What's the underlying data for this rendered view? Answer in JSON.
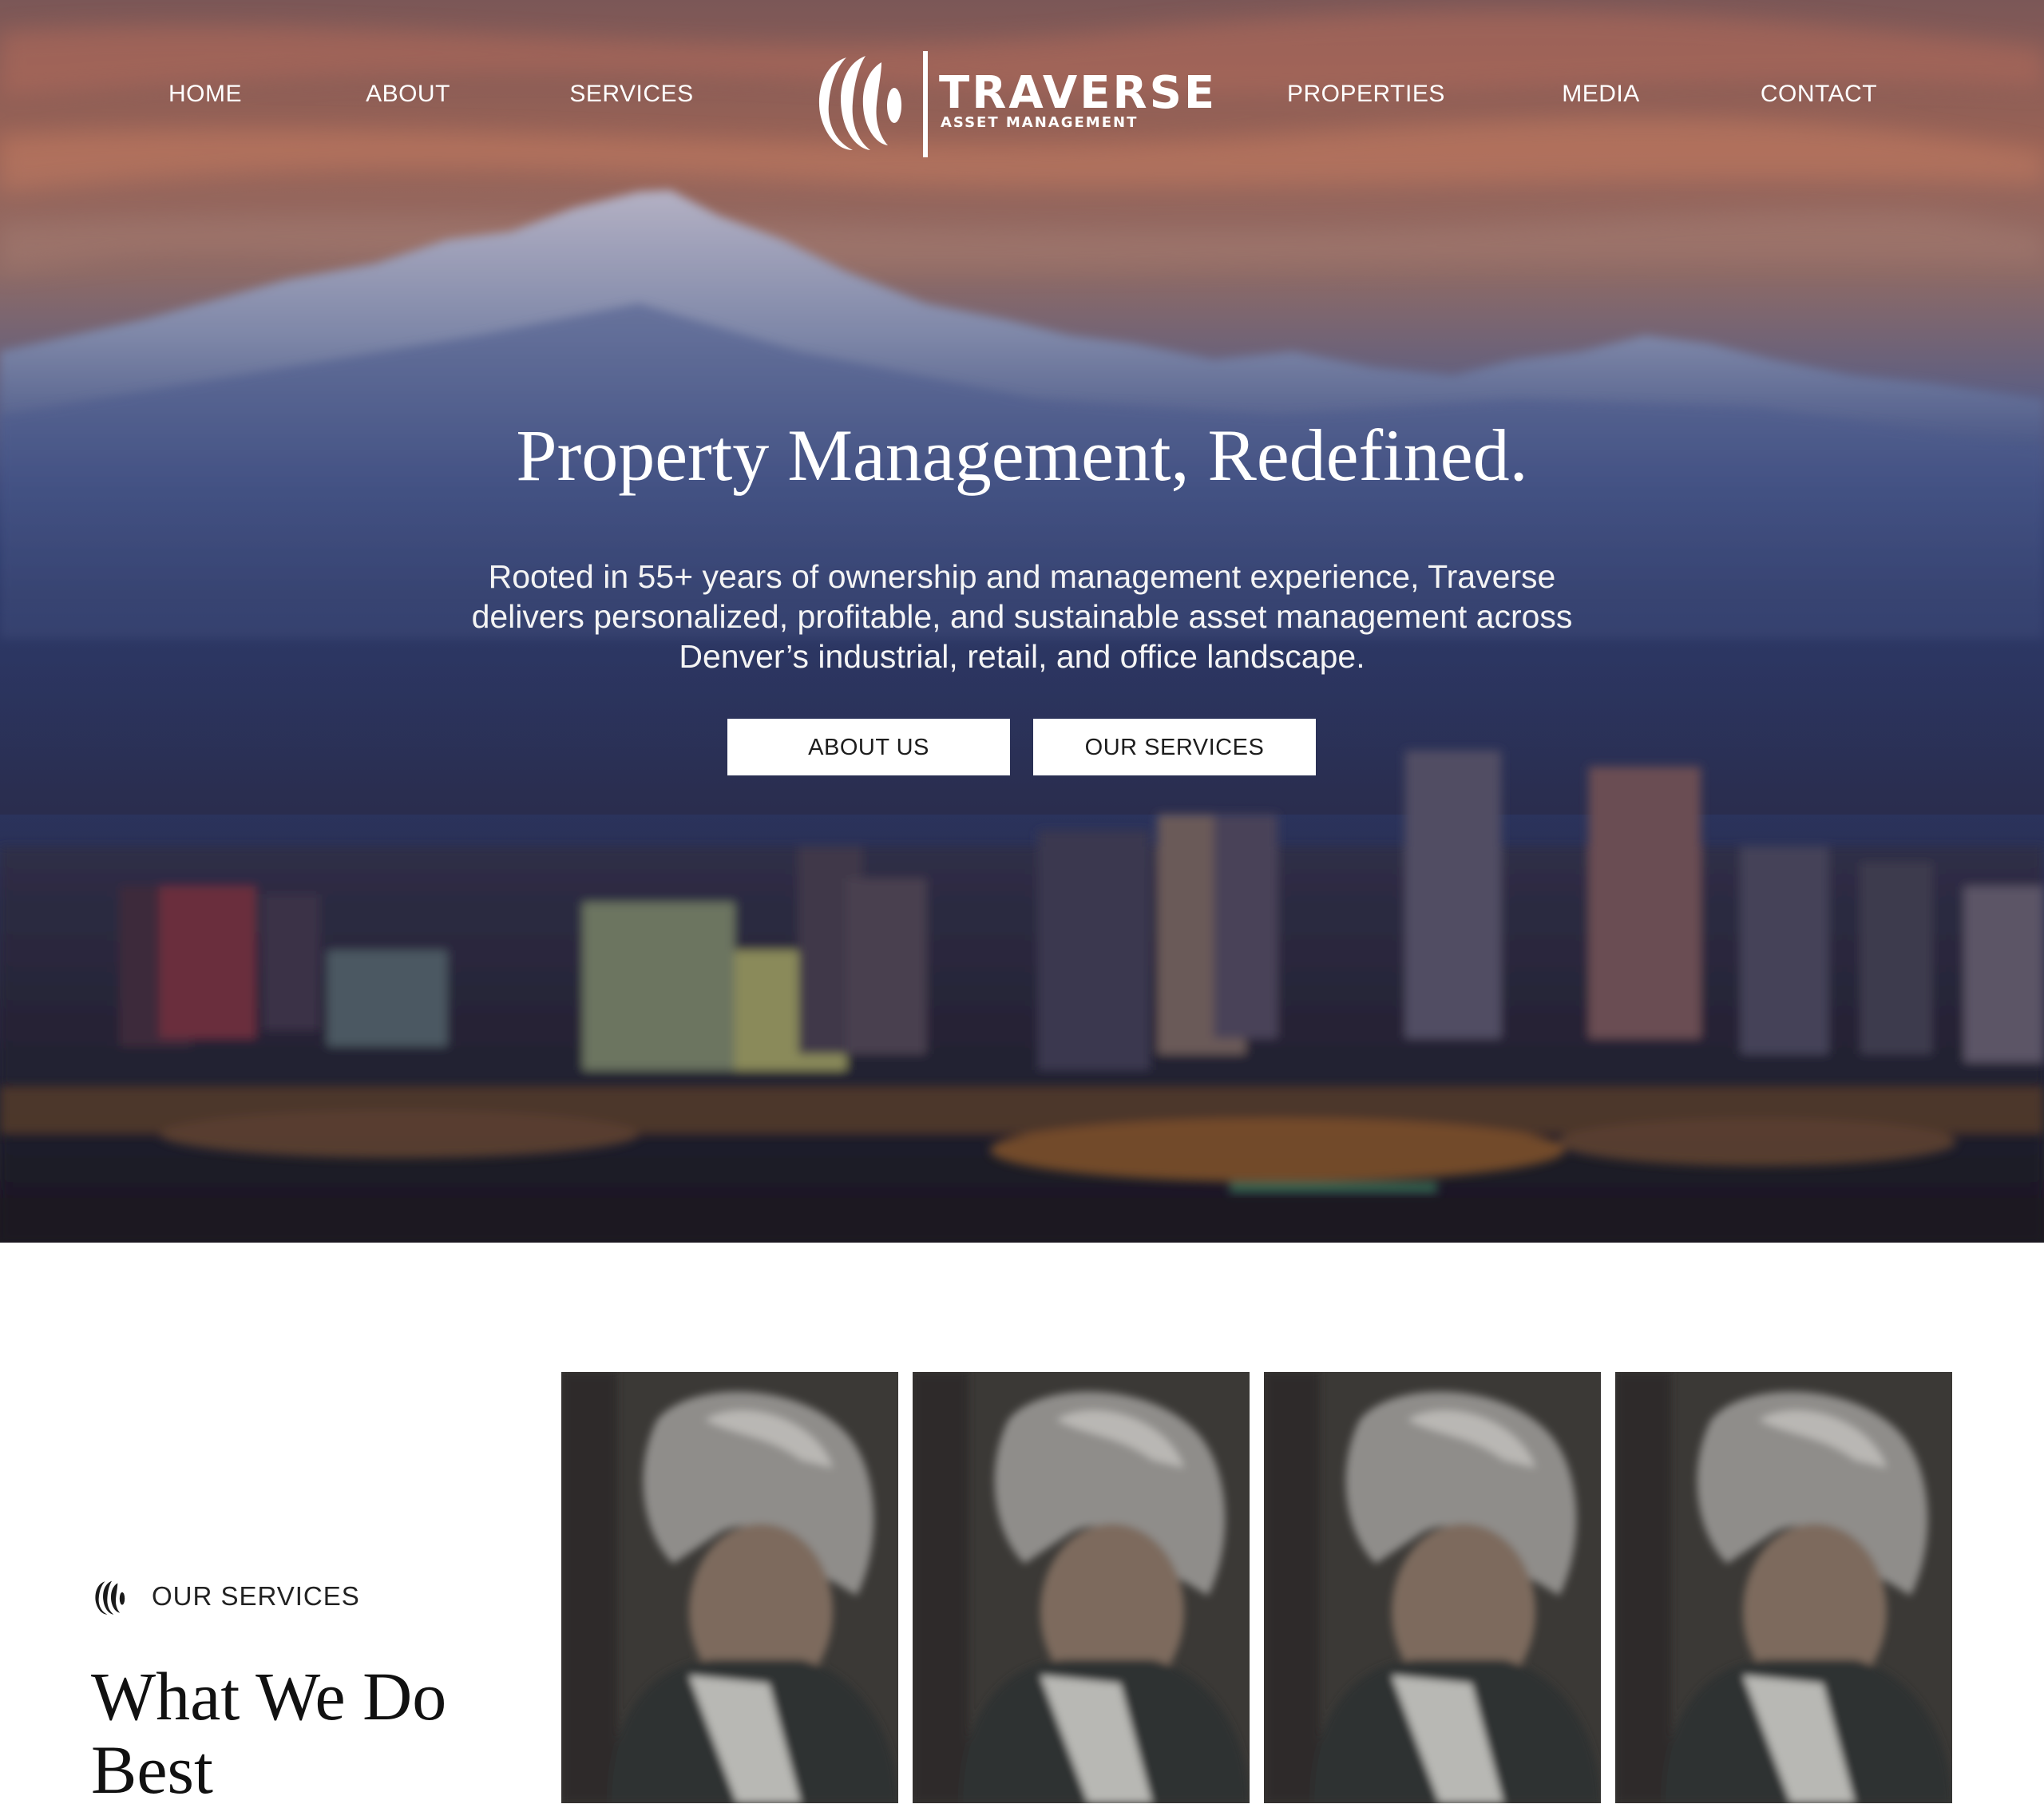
{
  "nav": {
    "left_items": [
      {
        "label": "HOME"
      },
      {
        "label": "ABOUT"
      },
      {
        "label": "SERVICES"
      }
    ],
    "right_items": [
      {
        "label": "PROPERTIES"
      },
      {
        "label": "MEDIA"
      },
      {
        "label": "CONTACT"
      }
    ]
  },
  "logo": {
    "title": "TRAVERSE",
    "subtitle": "ASSET MANAGEMENT",
    "icon": "traverse-rings-icon"
  },
  "hero": {
    "title": "Property Management, Redefined.",
    "subtitle": "Rooted in 55+ years of ownership and management experience, Traverse delivers personalized, profitable, and sustainable asset management across Denver’s industrial, retail, and office landscape.",
    "buttons": [
      {
        "label": "ABOUT US"
      },
      {
        "label": "OUR SERVICES"
      }
    ],
    "background": "mountain-city-skyline-image"
  },
  "services": {
    "eyebrow": "OUR SERVICES",
    "eyebrow_icon": "traverse-rings-icon",
    "heading": "What We Do Best",
    "cards": [
      {
        "image": "person-portrait-image"
      },
      {
        "image": "person-portrait-image"
      },
      {
        "image": "person-portrait-image"
      },
      {
        "image": "person-portrait-image"
      }
    ]
  },
  "colors": {
    "nav_text": "#ffffff",
    "button_bg": "#ffffff",
    "button_text": "#1d1d1d",
    "heading_dark": "#111111",
    "hero_sky_top": "#8a5a55",
    "hero_mountain": "#2e3d6b"
  }
}
